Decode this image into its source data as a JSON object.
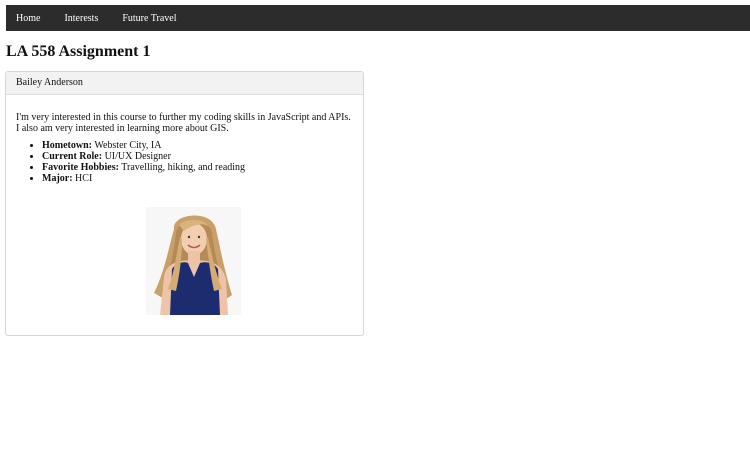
{
  "nav": {
    "items": [
      {
        "label": "Home"
      },
      {
        "label": "Interests"
      },
      {
        "label": "Future Travel"
      }
    ]
  },
  "page": {
    "title": "LA 558 Assignment 1"
  },
  "card": {
    "header": "Bailey Anderson",
    "intro": "I'm very interested in this course to further my coding skills in JavaScript and APIs. I also am very interested in learning more about GIS.",
    "facts": [
      {
        "label": "Hometown:",
        "value": "Webster City, IA"
      },
      {
        "label": "Current Role:",
        "value": "UI/UX Designer"
      },
      {
        "label": "Favorite Hobbies:",
        "value": "Travelling, hiking, and reading"
      },
      {
        "label": "Major:",
        "value": "HCI"
      }
    ]
  },
  "colors": {
    "navbar": "#2c2c2c",
    "card_header": "#f2f2f2",
    "card_border": "#d6d6d6"
  }
}
